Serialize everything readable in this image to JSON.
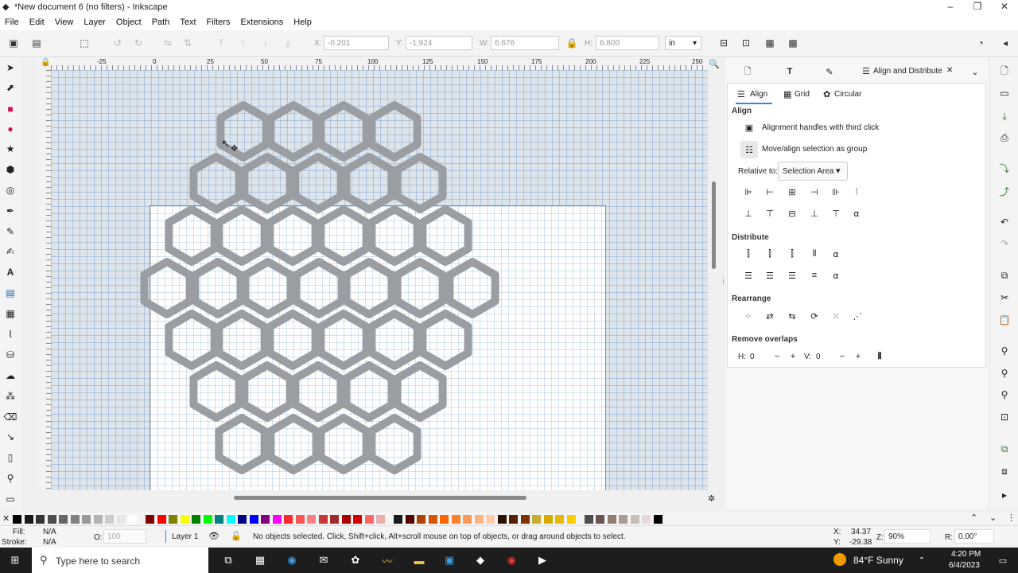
{
  "window": {
    "title": "*New document 6 (no filters) - Inkscape",
    "minimize": "–",
    "maximize": "❐",
    "close": "✕"
  },
  "menu": [
    "File",
    "Edit",
    "View",
    "Layer",
    "Object",
    "Path",
    "Text",
    "Filters",
    "Extensions",
    "Help"
  ],
  "toolbar": {
    "x_label": "X:",
    "x_value": "-0.201",
    "y_label": "Y:",
    "y_value": "-1.924",
    "w_label": "W:",
    "w_value": "6.676",
    "h_label": "H:",
    "h_value": "6.800",
    "units": "in"
  },
  "ruler": {
    "h_ticks": [
      "-25",
      "0",
      "25",
      "50",
      "75",
      "100",
      "125",
      "150",
      "175",
      "200",
      "225",
      "250"
    ]
  },
  "dock": {
    "tab_active": "Align and Distribute",
    "subtabs": [
      "Align",
      "Grid",
      "Circular"
    ],
    "align_title": "Align",
    "opt_handles": "Alignment handles with third click",
    "opt_group": "Move/align selection as group",
    "relative_label": "Relative to:",
    "relative_value": "Selection Area",
    "distribute_title": "Distribute",
    "rearrange_title": "Rearrange",
    "remove_overlaps_title": "Remove overlaps",
    "h_label": "H:",
    "h_value": "0",
    "v_label": "V:",
    "v_value": "0"
  },
  "palette_colors": [
    "#000000",
    "#1a1a1a",
    "#333333",
    "#4d4d4d",
    "#666666",
    "#808080",
    "#999999",
    "#b3b3b3",
    "#cccccc",
    "#e6e6e6",
    "#ffffff",
    "#800000",
    "#ff0000",
    "#808000",
    "#ffff00",
    "#008000",
    "#00ff00",
    "#008080",
    "#00ffff",
    "#000080",
    "#0000ff",
    "#800080",
    "#ff00ff",
    "#ff2a2a",
    "#ff5555",
    "#ff8080",
    "#c83737",
    "#a02c2c",
    "#aa0000",
    "#d40000",
    "#ff6666",
    "#e9afaf",
    "#1a1a1a",
    "#550000",
    "#aa4400",
    "#d45500",
    "#ff6600",
    "#ff7f2a",
    "#ff9955",
    "#ffb380",
    "#ffccaa",
    "#2b1100",
    "#552200",
    "#803300",
    "#c8ab37",
    "#d4aa00",
    "#e6b800",
    "#ffcc00",
    "#4d4d4d",
    "#6c5353",
    "#917c6f",
    "#ac9d93",
    "#c8beb7",
    "#e3dbdb",
    "#000000"
  ],
  "status": {
    "fill_label": "Fill:",
    "fill_value": "N/A",
    "stroke_label": "Stroke:",
    "stroke_value": "N/A",
    "opacity_label": "O:",
    "opacity_value": "100",
    "layer": "Layer 1",
    "message": "No objects selected. Click, Shift+click, Alt+scroll mouse on top of objects, or drag around objects to select.",
    "x_label": "X:",
    "x_coord": "34.37",
    "y_label": "Y:",
    "y_coord": "-29.38",
    "zoom_label": "Z:",
    "zoom": "90%",
    "rotation_label": "R:",
    "rotation": "0.00°"
  },
  "taskbar": {
    "search_placeholder": "Type here to search",
    "weather": "84°F  Sunny",
    "time": "4:20 PM",
    "date": "6/4/2023"
  }
}
